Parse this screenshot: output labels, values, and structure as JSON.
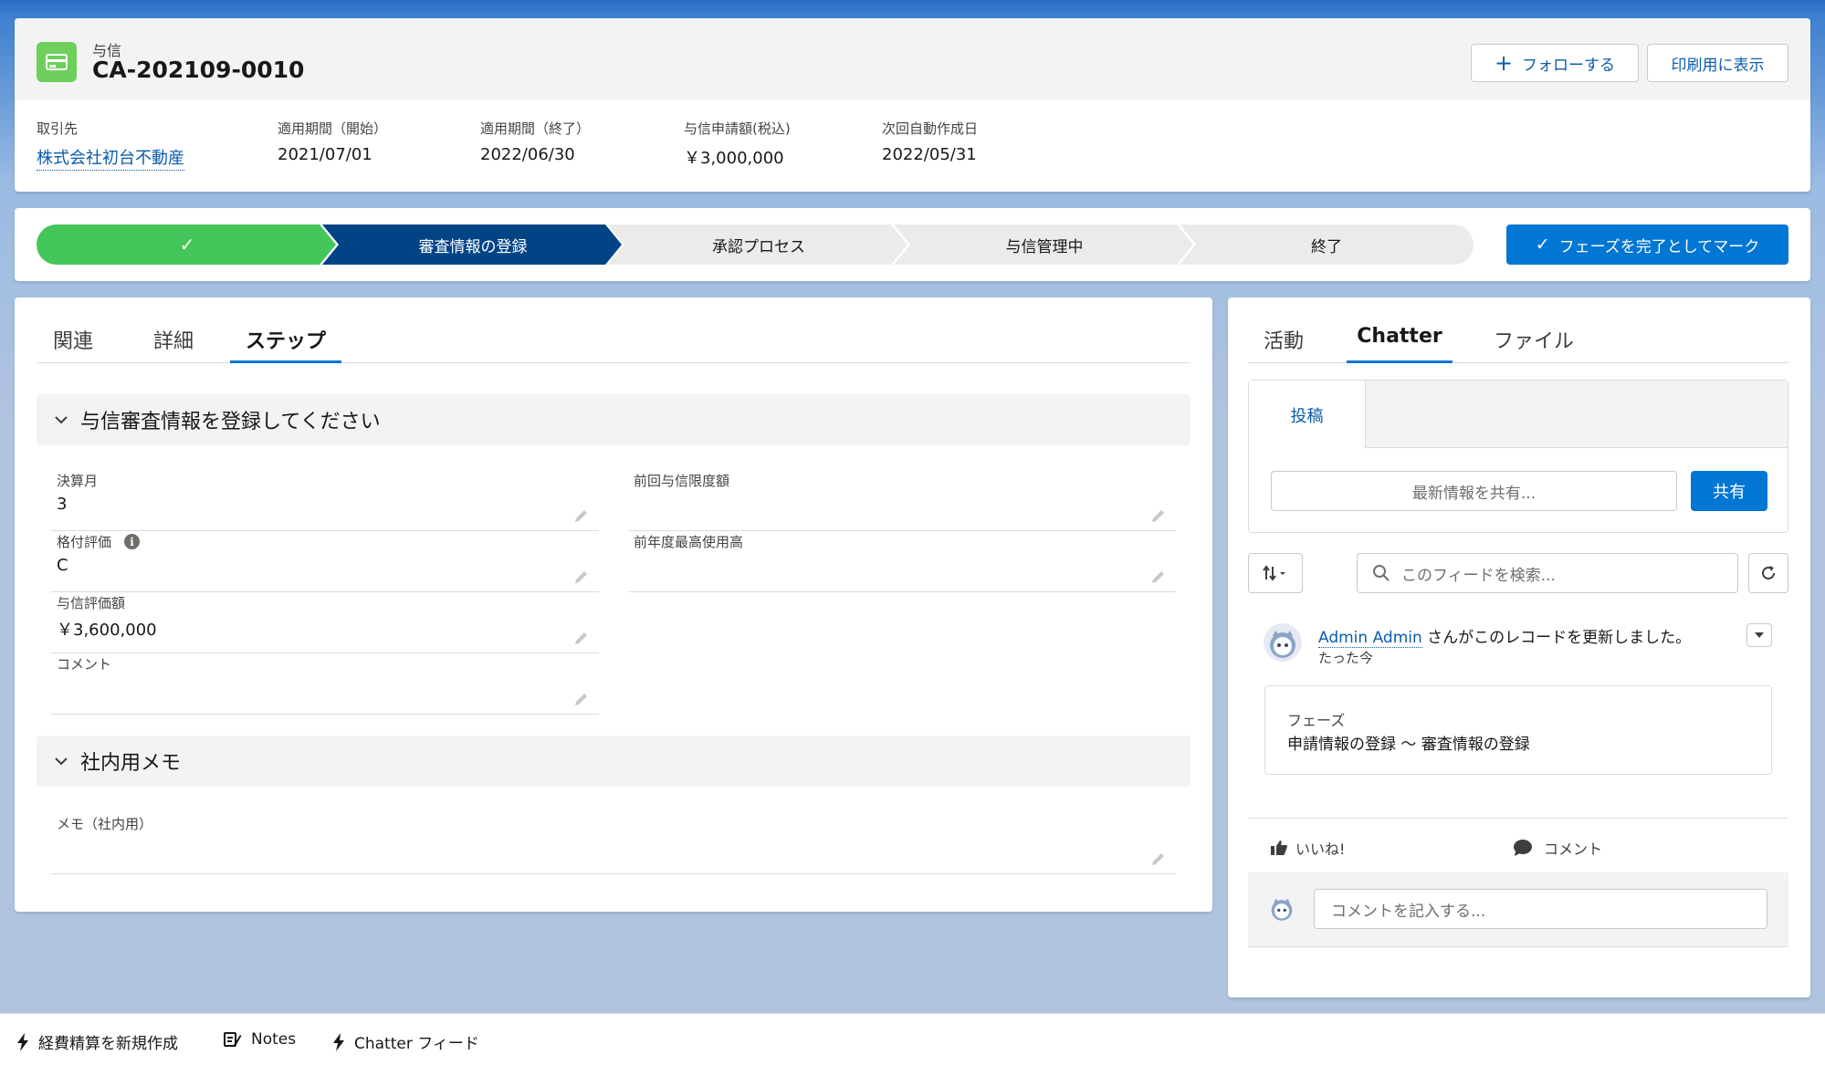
{
  "header": {
    "object_label": "与信",
    "record_title": "CA-202109-0010",
    "follow_label": "フォローする",
    "print_label": "印刷用に表示",
    "highlights": [
      {
        "label": "取引先",
        "value": "株式会社初台不動産"
      },
      {
        "label": "適用期間（開始）",
        "value": "2021/07/01"
      },
      {
        "label": "適用期間（終了）",
        "value": "2022/06/30"
      },
      {
        "label": "与信申請額(税込)",
        "value": "￥3,000,000"
      },
      {
        "label": "次回自動作成日",
        "value": "2022/05/31"
      }
    ]
  },
  "path": {
    "steps": [
      {
        "label": "✓",
        "state": "complete"
      },
      {
        "label": "審査情報の登録",
        "state": "current"
      },
      {
        "label": "承認プロセス",
        "state": "incomplete"
      },
      {
        "label": "与信管理中",
        "state": "incomplete"
      },
      {
        "label": "終了",
        "state": "incomplete"
      }
    ],
    "mark_label": "フェーズを完了としてマーク",
    "colors": {
      "complete": "#45c65a",
      "current": "#014486",
      "incomplete": "#ecebea"
    }
  },
  "main": {
    "tabs": [
      {
        "label": "関連"
      },
      {
        "label": "詳細"
      },
      {
        "label": "ステップ",
        "active": true
      }
    ],
    "section1": {
      "title": "与信審査情報を登録してください",
      "fields": [
        {
          "label": "決算月",
          "value": "3"
        },
        {
          "label": "格付評価",
          "value": "C"
        },
        {
          "label": "与信評価額",
          "value": "￥3,600,000"
        },
        {
          "label": "コメント",
          "value": ""
        },
        {
          "label": "前回与信限度額",
          "value": ""
        },
        {
          "label": "前年度最高使用高",
          "value": ""
        }
      ]
    },
    "section2": {
      "title": "社内用メモ",
      "fields": [
        {
          "label": "メモ（社内用）",
          "value": ""
        }
      ]
    }
  },
  "side": {
    "tabs": [
      {
        "label": "活動"
      },
      {
        "label": "Chatter",
        "active": true
      },
      {
        "label": "ファイル"
      }
    ],
    "publisher": {
      "tab_label": "投稿",
      "placeholder": "最新情報を共有...",
      "share_label": "共有"
    },
    "search_placeholder": "このフィードを検索...",
    "feed": {
      "author": "Admin Admin",
      "message": "さんがこのレコードを更新しました。",
      "time": "たった今",
      "change_label": "フェーズ",
      "change_value": "申請情報の登録 〜 審査情報の登録",
      "like_label": "いいね!",
      "comment_label": "コメント",
      "comment_placeholder": "コメントを記入する..."
    }
  },
  "utility_bar": [
    {
      "label": "経費精算を新規作成",
      "icon": "lightning-icon"
    },
    {
      "label": "Notes",
      "icon": "notes-icon"
    },
    {
      "label": "Chatter フィード",
      "icon": "lightning-icon"
    }
  ]
}
